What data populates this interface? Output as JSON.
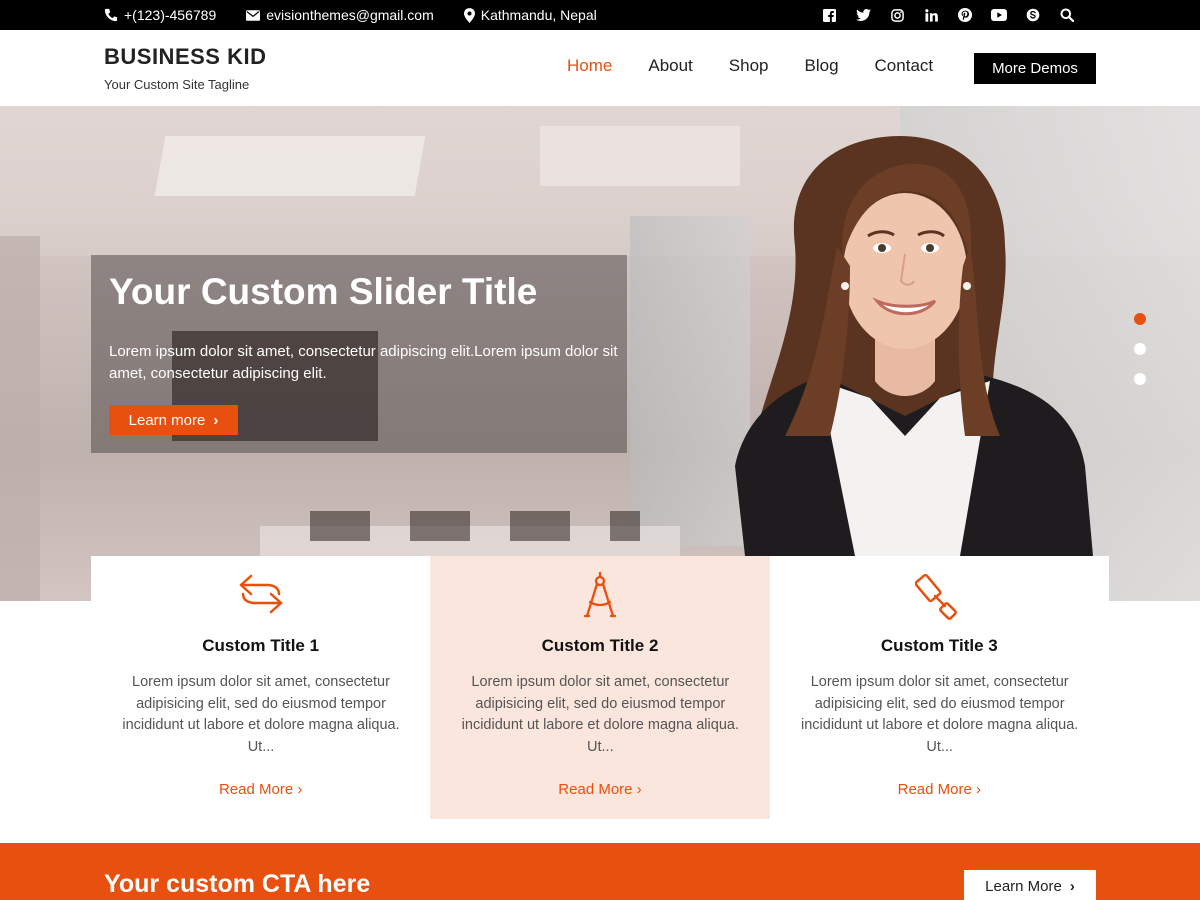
{
  "topbar": {
    "phone": "+(123)-456789",
    "email": "evisionthemes@gmail.com",
    "location": "Kathmandu, Nepal",
    "social_icons": [
      "facebook-icon",
      "twitter-icon",
      "instagram-icon",
      "linkedin-icon",
      "pinterest-icon",
      "youtube-icon",
      "skype-icon",
      "search-icon"
    ]
  },
  "header": {
    "site_title": "BUSINESS KID",
    "tagline": "Your Custom Site Tagline",
    "nav": [
      {
        "label": "Home",
        "active": true
      },
      {
        "label": "About",
        "active": false
      },
      {
        "label": "Shop",
        "active": false
      },
      {
        "label": "Blog",
        "active": false
      },
      {
        "label": "Contact",
        "active": false
      }
    ],
    "more_demos": "More Demos"
  },
  "slider": {
    "title": "Your Custom Slider Title",
    "text": "Lorem ipsum dolor sit amet, consectetur adipiscing elit.Lorem ipsum dolor sit amet, consectetur adipiscing elit.",
    "button": "Learn more",
    "dots": 3,
    "active_dot": 1
  },
  "features": [
    {
      "icon": "arrows-swap-icon",
      "title": "Custom Title 1",
      "text": "Lorem ipsum dolor sit amet, consectetur adipisicing elit, sed do eiusmod tempor incididunt ut labore et dolore magna aliqua. Ut...",
      "link": "Read More"
    },
    {
      "icon": "compass-icon",
      "title": "Custom Title 2",
      "text": "Lorem ipsum dolor sit amet, consectetur adipisicing elit, sed do eiusmod tempor incididunt ut labore et dolore magna aliqua. Ut...",
      "link": "Read More"
    },
    {
      "icon": "paint-roller-icon",
      "title": "Custom Title 3",
      "text": "Lorem ipsum dolor sit amet, consectetur adipisicing elit, sed do eiusmod tempor incididunt ut labore et dolore magna aliqua. Ut...",
      "link": "Read More"
    }
  ],
  "cta": {
    "title": "Your custom CTA here",
    "button": "Learn More"
  },
  "colors": {
    "accent": "#e8500f",
    "topbar": "#000000",
    "highlight": "#fbe6dd"
  }
}
